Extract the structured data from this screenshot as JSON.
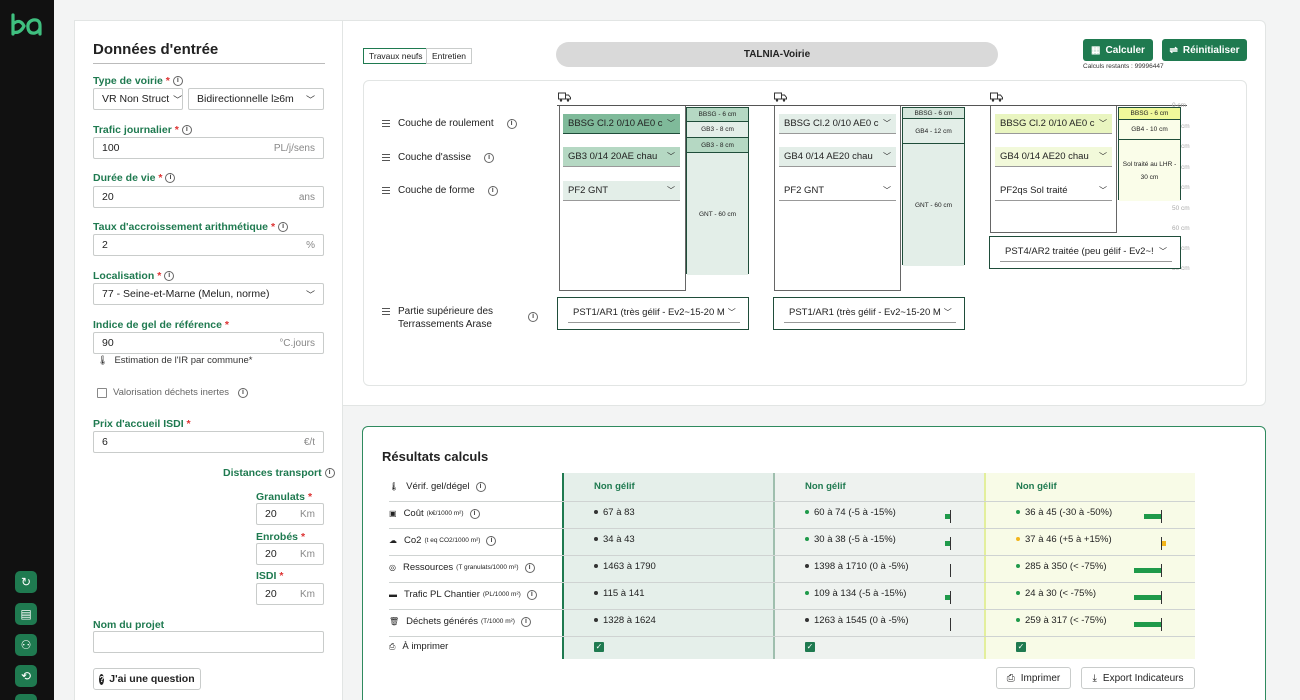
{
  "left": {
    "title": "Données d'entrée",
    "type_voirie": {
      "label": "Type de voirie",
      "value1": "VR Non Struct",
      "value2": "Bidirectionnelle l≥6m"
    },
    "trafic": {
      "label": "Trafic journalier",
      "value": "100",
      "unit": "PL/j/sens"
    },
    "duree": {
      "label": "Durée de vie",
      "value": "20",
      "unit": "ans"
    },
    "taux": {
      "label": "Taux d'accroissement arithmétique",
      "value": "2",
      "unit": "%"
    },
    "localisation": {
      "label": "Localisation",
      "value": "77 - Seine-et-Marne (Melun, norme)"
    },
    "gel": {
      "label": "Indice de gel de référence",
      "value": "90",
      "unit": "°C.jours",
      "note": "Estimation de l'IR par commune*"
    },
    "valorisation": "Valorisation déchets inertes",
    "prix": {
      "label": "Prix d'accueil ISDI",
      "value": "6",
      "unit": "€/t"
    },
    "distances": {
      "label": "Distances transport",
      "granulats": {
        "label": "Granulats",
        "value": "20",
        "unit": "Km"
      },
      "enrobes": {
        "label": "Enrobés",
        "value": "20",
        "unit": "Km"
      },
      "isdi": {
        "label": "ISDI",
        "value": "20",
        "unit": "Km"
      }
    },
    "projet": {
      "label": "Nom du projet",
      "value": ""
    },
    "question": "J'ai une question"
  },
  "top": {
    "tabs": [
      "Travaux neufs",
      "Entretien"
    ],
    "project_title": "TALNIA-Voirie",
    "calculer": "Calculer",
    "reinitialiser": "Réinitialiser",
    "calculs_restants": "Calculs restants : 99996447"
  },
  "structure": {
    "rows": [
      "Couche de roulement",
      "Couche d'assise",
      "Couche de forme"
    ],
    "pst_label_1": "Partie supérieure des",
    "pst_label_2": "Terrassements Arase",
    "depths": [
      "0 cm",
      "10 cm",
      "20 cm",
      "30 cm",
      "40 cm",
      "50 cm",
      "60 cm",
      "70 cm",
      "80 cm"
    ],
    "columns": [
      {
        "roulement": "BBSG Cl.2 0/10 AE0 c",
        "assise": "GB3 0/14 20AE chau",
        "forme": "PF2 GNT",
        "pst": "PST1/AR1 (très gélif - Ev2~15-20 M",
        "layers": [
          "BBSG - 6 cm",
          "GB3 - 8 cm",
          "GB3 - 8 cm",
          "GNT - 60 cm"
        ]
      },
      {
        "roulement": "BBSG Cl.2 0/10 AE0 c",
        "assise": "GB4 0/14 AE20 chau",
        "forme": "PF2 GNT",
        "pst": "PST1/AR1 (très gélif - Ev2~15-20 M",
        "layers": [
          "BBSG - 6 cm",
          "GB4 - 12 cm",
          "GNT - 60 cm"
        ]
      },
      {
        "roulement": "BBSG Cl.2 0/10 AE0 c",
        "assise": "GB4 0/14 AE20 chau",
        "forme": "PF2qs Sol traité",
        "pst": "PST4/AR2 traitée (peu gélif - Ev2~!",
        "layers": [
          "BBSG - 6 cm",
          "GB4 - 10 cm",
          "Sol traité au LHR - 30 cm"
        ]
      }
    ]
  },
  "results": {
    "title": "Résultats calculs",
    "rows": [
      {
        "label": "Vérif. gel/dégel",
        "unit": ""
      },
      {
        "label": "Coût",
        "unit": "(k€/1000 m²)"
      },
      {
        "label": "Co2",
        "unit": "(t eq CO2/1000 m²)"
      },
      {
        "label": "Ressources",
        "unit": "(T granulats/1000 m²)"
      },
      {
        "label": "Trafic PL Chantier",
        "unit": "(PL/1000 m²)"
      },
      {
        "label": "Déchets générés",
        "unit": "(T/1000 m²)"
      },
      {
        "label": "À imprimer",
        "unit": ""
      }
    ],
    "columns": [
      {
        "gel": "Non gélif",
        "values": [
          "67 à 83",
          "34 à 43",
          "1463 à 1790",
          "115 à 141",
          "1328 à 1624"
        ]
      },
      {
        "gel": "Non gélif",
        "values": [
          "60 à 74 (-5 à -15%)",
          "30 à 38 (-5 à -15%)",
          "1398 à 1710 (0 à -5%)",
          "109 à 134 (-5 à -15%)",
          "1263 à 1545 (0 à -5%)"
        ]
      },
      {
        "gel": "Non gélif",
        "values": [
          "36 à 45 (-30 à -50%)",
          "37 à 46 (+5 à +15%)",
          "285 à 350 (< -75%)",
          "24 à 30 (< -75%)",
          "259 à 317 (< -75%)"
        ]
      }
    ],
    "imprimer": "Imprimer",
    "export": "Export Indicateurs"
  },
  "colors": {
    "accent": "#1f7a50",
    "warning": "#f2b51c"
  }
}
